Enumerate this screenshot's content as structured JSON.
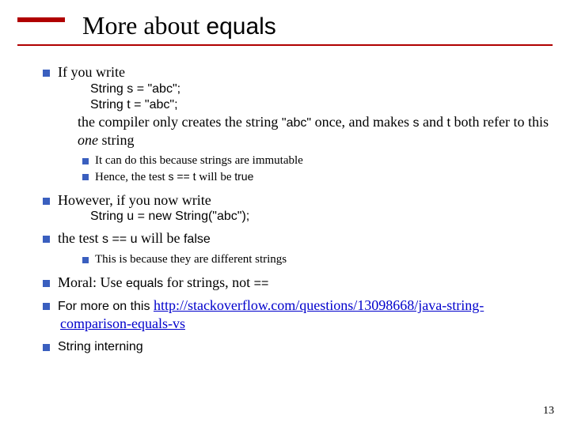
{
  "title": {
    "roman": "More about ",
    "sans": "equals"
  },
  "b1": {
    "lead": "If you write",
    "code1": "String s = \"abc\";",
    "code2": "String t = \"abc\";",
    "tail_a": "the compiler only creates the string ",
    "tail_abc": "\"abc\"",
    "tail_b": " once, and makes ",
    "tail_s": "s",
    "tail_c": " and ",
    "tail_t": "t",
    "tail_d": " both refer to this ",
    "tail_one": "one",
    "tail_e": " string",
    "sub1": "It can do this because strings are immutable",
    "sub2_a": "Hence, the test ",
    "sub2_code": "s == t",
    "sub2_b": " will be ",
    "sub2_true": "true"
  },
  "b2": {
    "lead": "However, if you now write",
    "code": "String u = new String(\"abc\");"
  },
  "b3": {
    "a": "the test ",
    "code": "s == u",
    "b": " will be ",
    "false": "false",
    "sub1": "This is because they are different strings"
  },
  "b4": {
    "a": "Moral: Use ",
    "eq": "equals",
    "b": " for strings, not ",
    "op": "=="
  },
  "b5": {
    "a": "For more on this ",
    "url": "http://stackoverflow.com/questions/13098668/java-string-comparison-equals-vs"
  },
  "b6": {
    "text": "String interning"
  },
  "slidenum": "13"
}
